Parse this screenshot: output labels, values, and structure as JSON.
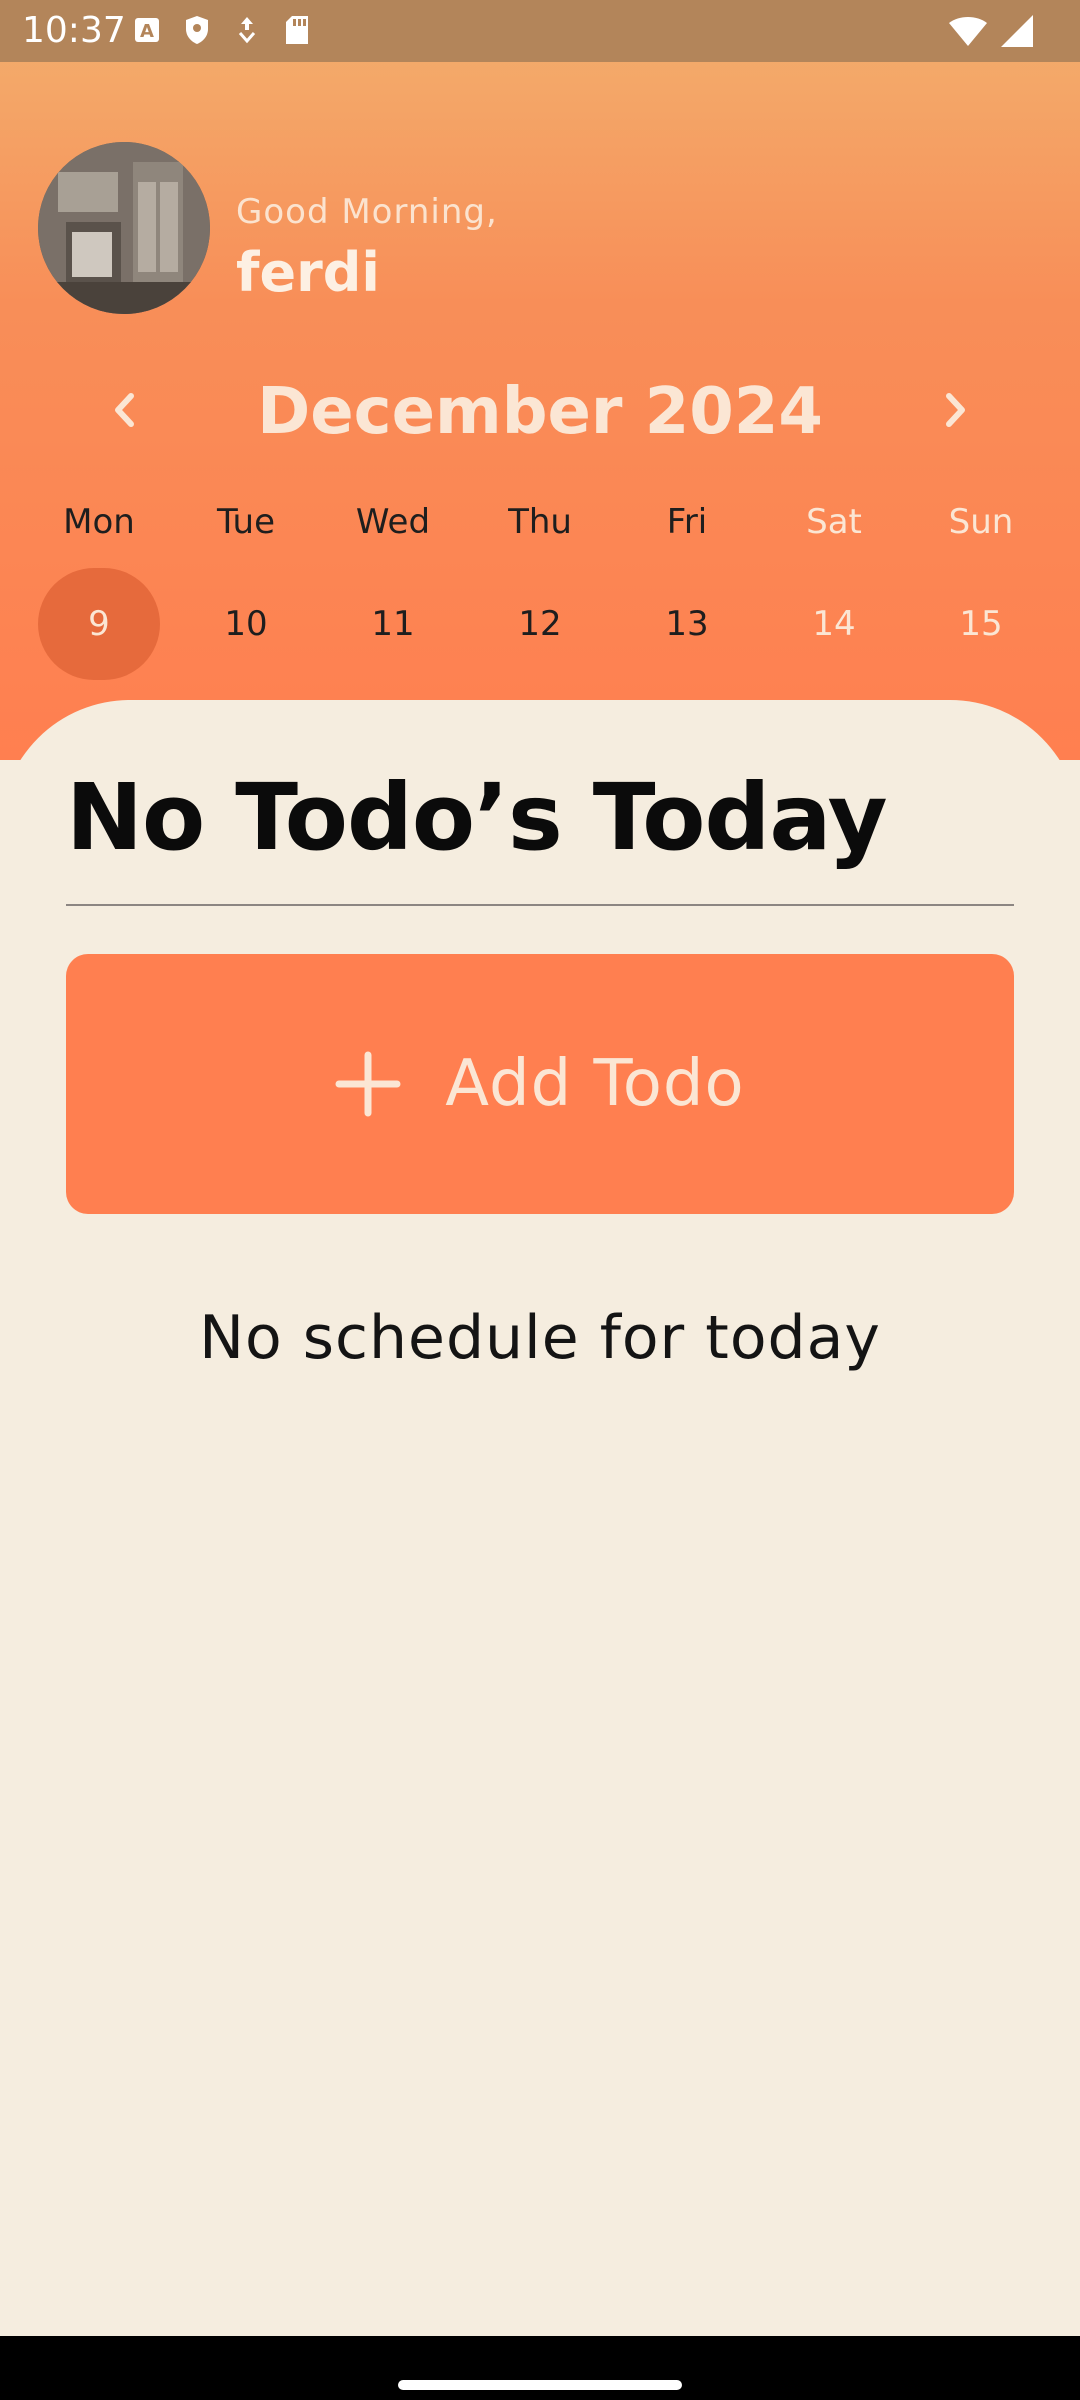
{
  "status_bar": {
    "time": "10:37",
    "icons_left": [
      "text-a-icon",
      "shield-icon",
      "download-icon",
      "sd-card-icon"
    ],
    "icons_right": [
      "wifi-icon",
      "signal-icon"
    ]
  },
  "header": {
    "greeting": "Good Morning,",
    "username": "ferdi",
    "avatar": "avatar"
  },
  "calendar": {
    "month_title": "December 2024",
    "prev_icon": "chevron-left-icon",
    "next_icon": "chevron-right-icon",
    "days": [
      {
        "name": "Mon",
        "num": "9"
      },
      {
        "name": "Tue",
        "num": "10"
      },
      {
        "name": "Wed",
        "num": "11"
      },
      {
        "name": "Thu",
        "num": "12"
      },
      {
        "name": "Fri",
        "num": "13"
      },
      {
        "name": "Sat",
        "num": "14"
      },
      {
        "name": "Sun",
        "num": "15"
      }
    ],
    "selected_index": 0
  },
  "content": {
    "title": "No Todo’s Today",
    "add_button": "Add Todo",
    "empty_message": "No schedule for today"
  },
  "colors": {
    "status_bar": "#B3855A",
    "accent": "#FF7F50",
    "selected_day": "#E66A3C",
    "panel": "#F5EDDF"
  }
}
